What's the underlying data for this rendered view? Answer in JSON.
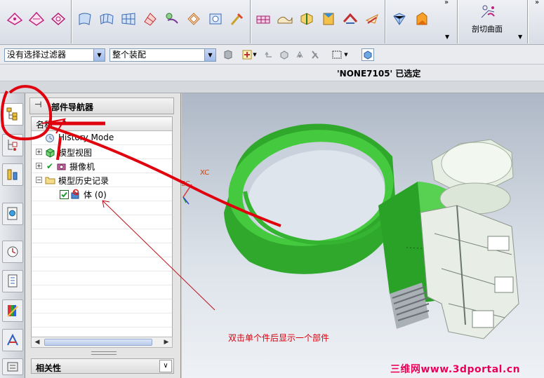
{
  "toolbar": {
    "icons": [
      "surface-icon",
      "surface-icon",
      "surface-icon",
      "ruled-surface-icon",
      "through-curves-icon",
      "mesh-surface-icon",
      "swept-icon",
      "law-extension-icon",
      "offset-surface-icon",
      "trim-icon",
      "extend-icon",
      "blend-icon",
      "curvature-icon",
      "section-icon",
      "enlarge-icon",
      "thicken-icon",
      "sew-icon",
      "bridge-icon",
      "silhouette-icon",
      "face-blend-icon",
      "styled-icon"
    ],
    "more_glyph": "»",
    "section_label": "剖切曲面"
  },
  "selection_bar": {
    "filter_value": "没有选择过滤器",
    "scope_value": "整个装配",
    "status_text": "'NONE7105' 已选定"
  },
  "resource_bar": {
    "tabs": [
      "assembly-navigator-icon",
      "part-navigator-icon",
      "constraint-icon",
      "web-browser-icon",
      "history-icon",
      "roles-icon",
      "system-materials-icon",
      "palette-icon",
      "info-icon"
    ]
  },
  "navigator": {
    "title": "部件导航器",
    "column_name": "名称",
    "rows": [
      {
        "label": "History Mode"
      },
      {
        "label": "模型视图"
      },
      {
        "label": "摄像机"
      },
      {
        "label": "模型历史记录"
      },
      {
        "label": "体 (0)"
      }
    ],
    "dependency_title": "相关性"
  },
  "viewport": {
    "axis_x": "XC",
    "axis_z": "ZC"
  },
  "annotation": "双击单个件后显示一个部件",
  "watermark": "三维网www.3dportal.cn",
  "colors": {
    "part_green": "#3fbf3a",
    "annotation_red": "#e0000d",
    "watermark_pink": "#e8005a"
  }
}
